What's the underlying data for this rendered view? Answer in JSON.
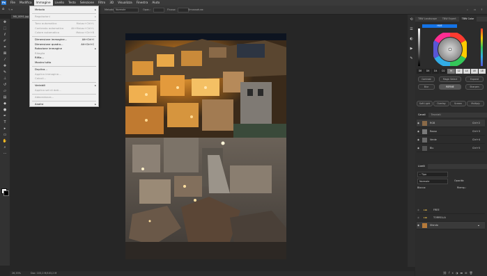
{
  "menubar": {
    "items": [
      "File",
      "Modifica",
      "Immagine",
      "Livello",
      "Testo",
      "Selezione",
      "Filtro",
      "3D",
      "Visualizza",
      "Finestra",
      "Aiuto"
    ],
    "active": "Immagine"
  },
  "options": {
    "mode_label": "Metodo:",
    "mode_value": "Normale",
    "opacity_label": "Opac.:",
    "flow_label": "Flusso:",
    "smooth_label": "Smussatura:"
  },
  "document": {
    "tab_label": "MU_0091.jpg"
  },
  "image_menu": {
    "items": [
      {
        "label": "Metodo",
        "shortcut": "",
        "submenu": true,
        "disabled": false
      },
      {
        "sep": true
      },
      {
        "label": "Regolazioni",
        "shortcut": "",
        "submenu": true,
        "disabled": true
      },
      {
        "sep": true
      },
      {
        "label": "Tono automatico",
        "shortcut": "Maiusc+Ctrl+L",
        "submenu": false,
        "disabled": true
      },
      {
        "label": "Contrasto automatico",
        "shortcut": "Alt+Maiusc+Ctrl+L",
        "submenu": false,
        "disabled": true
      },
      {
        "label": "Colore automatico",
        "shortcut": "Maiusc+Ctrl+B",
        "submenu": false,
        "disabled": true
      },
      {
        "sep": true
      },
      {
        "label": "Dimensione immagine...",
        "shortcut": "Alt+Ctrl+I",
        "submenu": false,
        "disabled": false
      },
      {
        "label": "Dimensione quadro...",
        "shortcut": "Alt+Ctrl+C",
        "submenu": false,
        "disabled": false
      },
      {
        "label": "Rotazione immagine",
        "shortcut": "",
        "submenu": true,
        "disabled": false
      },
      {
        "label": "Ritaglia",
        "shortcut": "",
        "submenu": false,
        "disabled": true
      },
      {
        "label": "Rifila...",
        "shortcut": "",
        "submenu": false,
        "disabled": false
      },
      {
        "label": "Mostra tutto",
        "shortcut": "",
        "submenu": false,
        "disabled": false
      },
      {
        "sep": true
      },
      {
        "label": "Duplica...",
        "shortcut": "",
        "submenu": false,
        "disabled": false
      },
      {
        "label": "Applica immagine...",
        "shortcut": "",
        "submenu": false,
        "disabled": true
      },
      {
        "label": "Calcoli...",
        "shortcut": "",
        "submenu": false,
        "disabled": true
      },
      {
        "sep": true
      },
      {
        "label": "Variabili",
        "shortcut": "",
        "submenu": true,
        "disabled": false
      },
      {
        "label": "Applica set di dati...",
        "shortcut": "",
        "submenu": false,
        "disabled": true
      },
      {
        "sep": true
      },
      {
        "label": "Abbondanza...",
        "shortcut": "",
        "submenu": false,
        "disabled": true
      },
      {
        "sep": true
      },
      {
        "label": "Analisi",
        "shortcut": "",
        "submenu": true,
        "disabled": false
      }
    ]
  },
  "color_panel": {
    "tabs": [
      "TBW Landscape",
      "TBW Expert",
      "TBW Color"
    ],
    "active_tab": "TBW Color",
    "mode_label": "HUE",
    "zone_buttons": [
      "D8",
      "D6",
      "D4",
      "D2",
      "M",
      "L2",
      "L4",
      "L6",
      "L8"
    ],
    "buttons": [
      "Contrast",
      "Magic Select",
      "Expand",
      "Blur",
      "REFINE",
      "Sharpen",
      "Soft Light",
      "Overlay",
      "Screen",
      "Multiply"
    ]
  },
  "channels_panel": {
    "tabs": [
      "Canali",
      "Tracciati"
    ],
    "rows": [
      {
        "name": "RGB",
        "shortcut": "Ctrl+2"
      },
      {
        "name": "Rosso",
        "shortcut": "Ctrl+3"
      },
      {
        "name": "Verde",
        "shortcut": "Ctrl+4"
      },
      {
        "name": "Blu",
        "shortcut": "Ctrl+5"
      }
    ]
  },
  "layers_panel": {
    "title": "Livelli",
    "kind_label": "Tipo",
    "blend_mode": "Normale",
    "opacity_label": "Opacità:",
    "lock_label": "Blocca:",
    "fill_label": "Riemp.:",
    "layers": [
      {
        "name": "FREE",
        "type": "group"
      },
      {
        "name": "TORRELLA",
        "type": "group"
      },
      {
        "name": "Sfondo",
        "type": "image"
      }
    ]
  },
  "status": {
    "zoom": "26,33%",
    "doc_info": "Doc: 103,2 M/103,2 M"
  },
  "colors": {
    "accent": "#1473e6",
    "menubar": "#3a3a3a",
    "panel": "#2c2c2c"
  }
}
